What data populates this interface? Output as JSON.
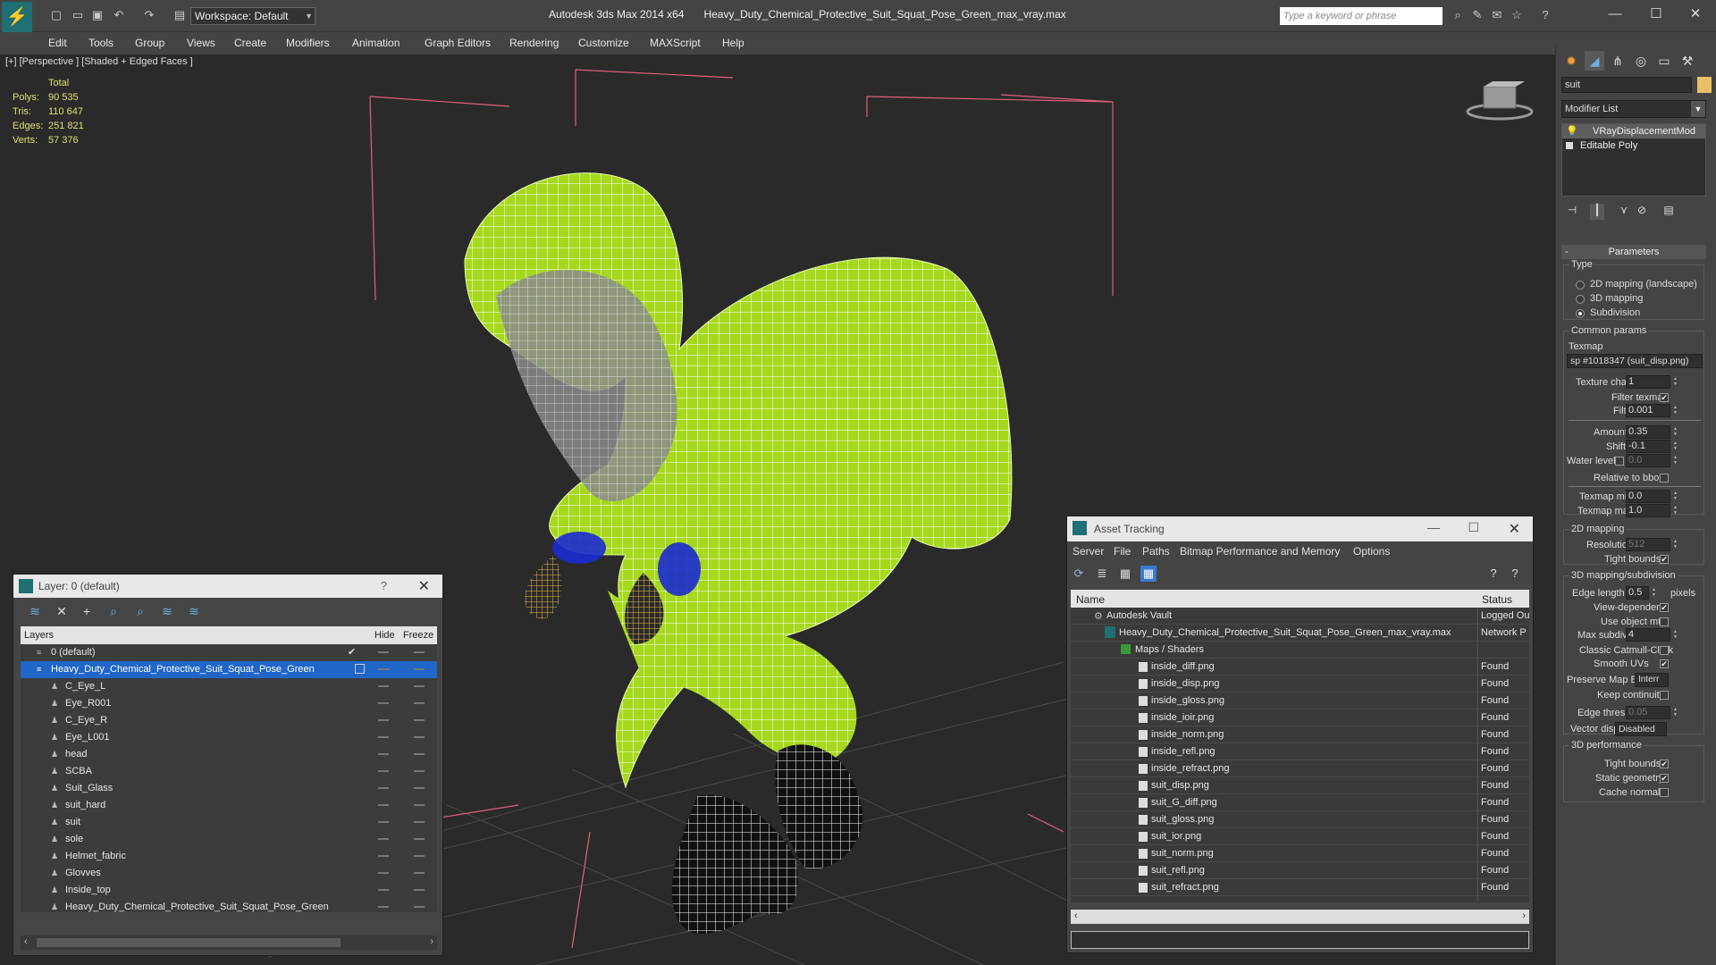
{
  "titlebar": {
    "workspace": "Workspace: Default",
    "app_title": "Autodesk 3ds Max  2014 x64",
    "file_title": "Heavy_Duty_Chemical_Protective_Suit_Squat_Pose_Green_max_vray.max",
    "search_placeholder": "Type a keyword or phrase"
  },
  "menu": [
    "Edit",
    "Tools",
    "Group",
    "Views",
    "Create",
    "Modifiers",
    "Animation",
    "Graph Editors",
    "Rendering",
    "Customize",
    "MAXScript",
    "Help"
  ],
  "viewport": {
    "label": "[+] [Perspective ] [Shaded + Edged Faces ]",
    "stats_total": "Total",
    "stats": [
      {
        "k": "Polys:",
        "v": "90 535"
      },
      {
        "k": "Tris:",
        "v": "110 647"
      },
      {
        "k": "Edges:",
        "v": "251 821"
      },
      {
        "k": "Verts:",
        "v": "57 376"
      }
    ]
  },
  "layer_panel": {
    "title": "Layer: 0 (default)",
    "help": "?",
    "col_layers": "Layers",
    "col_hide": "Hide",
    "col_freeze": "Freeze",
    "rows": [
      {
        "name": "0 (default)",
        "level": 0,
        "selected": false
      },
      {
        "name": "Heavy_Duty_Chemical_Protective_Suit_Squat_Pose_Green",
        "level": 0,
        "selected": true
      },
      {
        "name": "C_Eye_L",
        "level": 1,
        "selected": false
      },
      {
        "name": "Eye_R001",
        "level": 1,
        "selected": false
      },
      {
        "name": "C_Eye_R",
        "level": 1,
        "selected": false
      },
      {
        "name": "Eye_L001",
        "level": 1,
        "selected": false
      },
      {
        "name": "head",
        "level": 1,
        "selected": false
      },
      {
        "name": "SCBA",
        "level": 1,
        "selected": false
      },
      {
        "name": "Suit_Glass",
        "level": 1,
        "selected": false
      },
      {
        "name": "suit_hard",
        "level": 1,
        "selected": false
      },
      {
        "name": "suit",
        "level": 1,
        "selected": false
      },
      {
        "name": "sole",
        "level": 1,
        "selected": false
      },
      {
        "name": "Helmet_fabric",
        "level": 1,
        "selected": false
      },
      {
        "name": "Glovves",
        "level": 1,
        "selected": false
      },
      {
        "name": "Inside_top",
        "level": 1,
        "selected": false
      },
      {
        "name": "Heavy_Duty_Chemical_Protective_Suit_Squat_Pose_Green",
        "level": 1,
        "selected": false
      }
    ]
  },
  "asset_panel": {
    "title": "Asset Tracking",
    "menu": [
      "Server",
      "File",
      "Paths",
      "Bitmap Performance and Memory",
      "Options"
    ],
    "col_name": "Name",
    "col_status": "Status",
    "rows": [
      {
        "name": "Autodesk Vault",
        "status": "Logged Ou",
        "level": 1
      },
      {
        "name": "Heavy_Duty_Chemical_Protective_Suit_Squat_Pose_Green_max_vray.max",
        "status": "Network P",
        "level": 2
      },
      {
        "name": "Maps / Shaders",
        "status": "",
        "level": 3
      },
      {
        "name": "inside_diff.png",
        "status": "Found",
        "level": 4
      },
      {
        "name": "inside_disp.png",
        "status": "Found",
        "level": 4
      },
      {
        "name": "inside_gloss.png",
        "status": "Found",
        "level": 4
      },
      {
        "name": "inside_ioir.png",
        "status": "Found",
        "level": 4
      },
      {
        "name": "inside_norm.png",
        "status": "Found",
        "level": 4
      },
      {
        "name": "inside_refl.png",
        "status": "Found",
        "level": 4
      },
      {
        "name": "inside_refract.png",
        "status": "Found",
        "level": 4
      },
      {
        "name": "suit_disp.png",
        "status": "Found",
        "level": 4
      },
      {
        "name": "suit_G_diff.png",
        "status": "Found",
        "level": 4
      },
      {
        "name": "suit_gloss.png",
        "status": "Found",
        "level": 4
      },
      {
        "name": "suit_ior.png",
        "status": "Found",
        "level": 4
      },
      {
        "name": "suit_norm.png",
        "status": "Found",
        "level": 4
      },
      {
        "name": "suit_refl.png",
        "status": "Found",
        "level": 4
      },
      {
        "name": "suit_refract.png",
        "status": "Found",
        "level": 4
      }
    ]
  },
  "command_panel": {
    "object_name": "suit",
    "modifier_list": "Modifier List",
    "stack": [
      "VRayDisplacementMod",
      "Editable Poly"
    ],
    "rollout_title": "Parameters",
    "type_group": "Type",
    "type_options": [
      "2D mapping (landscape)",
      "3D mapping",
      "Subdivision"
    ],
    "common_group": "Common params",
    "texmap_label": "Texmap",
    "texmap_value": "sp #1018347 (suit_disp.png)",
    "texture_chan_label": "Texture chan",
    "texture_chan": "1",
    "filter_texmap_label": "Filter texmap",
    "filter_blur_label": "Filter blur",
    "filter_blur": "0.001",
    "amount_label": "Amount",
    "amount": "0.35",
    "shift_label": "Shift",
    "shift": "-0.1",
    "water_level_label": "Water level",
    "water_level": "0.0",
    "relative_bbox_label": "Relative to bbox",
    "texmap_min_label": "Texmap min",
    "texmap_min": "0.0",
    "texmap_max_label": "Texmap max",
    "texmap_max": "1.0",
    "mapping2d_group": "2D mapping",
    "resolution_label": "Resolution",
    "resolution": "512",
    "tight_bounds_label": "Tight bounds",
    "mapping3d_group": "3D mapping/subdivision",
    "edge_length_label": "Edge length",
    "edge_length": "0.5",
    "pixels_label": "pixels",
    "view_dependent_label": "View-dependent",
    "use_object_mtl_label": "Use object mtl",
    "max_subdivs_label": "Max subdivs",
    "max_subdivs": "4",
    "catmull_label": "Classic Catmull-Clark",
    "smooth_uvs_label": "Smooth UVs",
    "preserve_map_label": "Preserve Map Bnd",
    "preserve_map_value": "Interr",
    "keep_continuity_label": "Keep continuity",
    "edge_thresh_label": "Edge thresh",
    "edge_thresh": "0.05",
    "vector_displ_label": "Vector displ",
    "vector_displ_value": "Disabled",
    "perf_group": "3D performance",
    "perf_tight_bounds_label": "Tight bounds",
    "static_geometry_label": "Static geometry",
    "cache_normals_label": "Cache normals"
  },
  "colors": {
    "suit_green": "#a6d81e",
    "boot_black": "#111111",
    "glove_yellow": "#e8b84a",
    "cuff_blue": "#1a2ad0",
    "bbox_pink": "#e0607a",
    "selection_blue": "#1f66c8"
  }
}
